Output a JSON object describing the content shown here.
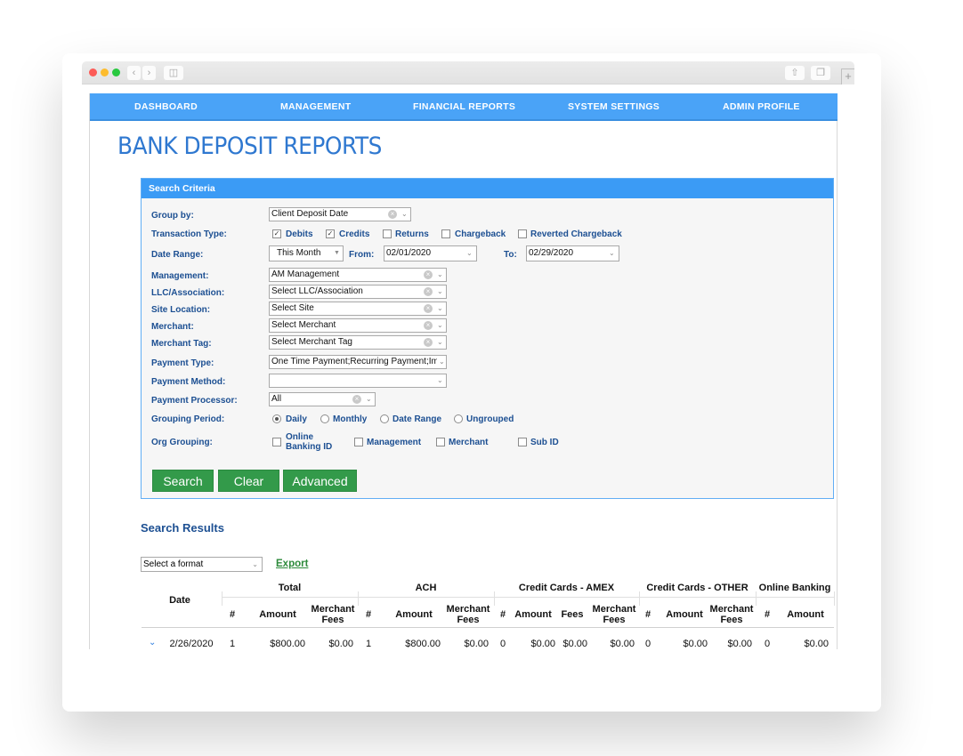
{
  "nav": {
    "items": [
      "DASHBOARD",
      "MANAGEMENT",
      "FINANCIAL REPORTS",
      "SYSTEM SETTINGS",
      "ADMIN PROFILE"
    ]
  },
  "page_title": "BANK DEPOSIT REPORTS",
  "criteria": {
    "title": "Search Criteria",
    "group_by": {
      "label": "Group by:",
      "value": "Client Deposit Date"
    },
    "transaction_type": {
      "label": "Transaction Type:",
      "options": [
        {
          "label": "Debits",
          "checked": true
        },
        {
          "label": "Credits",
          "checked": true
        },
        {
          "label": "Returns",
          "checked": false
        },
        {
          "label": "Chargeback",
          "checked": false
        },
        {
          "label": "Reverted Chargeback",
          "checked": false
        }
      ]
    },
    "date_range": {
      "label": "Date Range:",
      "preset": "This Month",
      "from_label": "From:",
      "from": "02/01/2020",
      "to_label": "To:",
      "to": "02/29/2020"
    },
    "management": {
      "label": "Management:",
      "value": "AM Management"
    },
    "llc": {
      "label": "LLC/Association:",
      "value": "Select LLC/Association"
    },
    "site": {
      "label": "Site Location:",
      "value": "Select Site"
    },
    "merchant": {
      "label": "Merchant:",
      "value": "Select Merchant"
    },
    "merchant_tag": {
      "label": "Merchant Tag:",
      "value": "Select Merchant Tag"
    },
    "payment_type": {
      "label": "Payment Type:",
      "value": "One Time Payment;Recurring Payment;Imp"
    },
    "payment_method": {
      "label": "Payment Method:",
      "value": ""
    },
    "payment_processor": {
      "label": "Payment Processor:",
      "value": "All"
    },
    "grouping_period": {
      "label": "Grouping Period:",
      "options": [
        {
          "label": "Daily",
          "selected": true
        },
        {
          "label": "Monthly",
          "selected": false
        },
        {
          "label": "Date Range",
          "selected": false
        },
        {
          "label": "Ungrouped",
          "selected": false
        }
      ]
    },
    "org_grouping": {
      "label": "Org Grouping:",
      "options": [
        {
          "label_line1": "Online",
          "label_line2": "Banking ID",
          "checked": false
        },
        {
          "label": "Management",
          "checked": false
        },
        {
          "label": "Merchant",
          "checked": false
        },
        {
          "label": "Sub ID",
          "checked": false
        }
      ]
    },
    "buttons": {
      "search": "Search",
      "clear": "Clear",
      "advanced": "Advanced"
    }
  },
  "results": {
    "title": "Search Results",
    "format_placeholder": "Select a format",
    "export_label": "Export",
    "table": {
      "date_header": "Date",
      "groups": [
        "Total",
        "ACH",
        "Credit Cards - AMEX",
        "Credit Cards - OTHER",
        "Online Banking"
      ],
      "subheaders": {
        "total": [
          "#",
          "Amount",
          "Merchant Fees"
        ],
        "ach": [
          "#",
          "Amount",
          "Merchant Fees"
        ],
        "amex": [
          "#",
          "Amount",
          "Fees",
          "Merchant Fees"
        ],
        "other": [
          "#",
          "Amount",
          "Merchant Fees"
        ],
        "online": [
          "#",
          "Amount"
        ]
      },
      "rows": [
        {
          "date": "2/26/2020",
          "total": [
            "1",
            "$800.00",
            "$0.00"
          ],
          "ach": [
            "1",
            "$800.00",
            "$0.00"
          ],
          "amex": [
            "0",
            "$0.00",
            "$0.00",
            "$0.00"
          ],
          "other": [
            "0",
            "$0.00",
            "$0.00"
          ],
          "online": [
            "0",
            "$0.00"
          ]
        }
      ]
    }
  }
}
